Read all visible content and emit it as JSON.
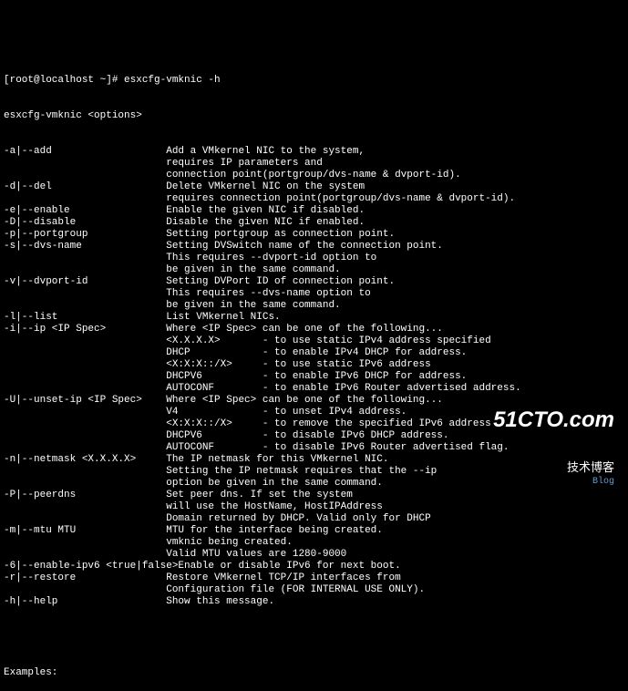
{
  "prompt": "[root@localhost ~]# esxcfg-vmknic -h",
  "usage_line": "esxcfg-vmknic <options>",
  "options": [
    {
      "flag": "-a|--add",
      "lines": [
        "Add a VMkernel NIC to the system,",
        "requires IP parameters and",
        "connection point(portgroup/dvs-name & dvport-id)."
      ]
    },
    {
      "flag": "-d|--del",
      "lines": [
        "Delete VMkernel NIC on the system",
        "requires connection point(portgroup/dvs-name & dvport-id)."
      ]
    },
    {
      "flag": "-e|--enable",
      "lines": [
        "Enable the given NIC if disabled."
      ]
    },
    {
      "flag": "-D|--disable",
      "lines": [
        "Disable the given NIC if enabled."
      ]
    },
    {
      "flag": "-p|--portgroup",
      "lines": [
        "Setting portgroup as connection point."
      ]
    },
    {
      "flag": "-s|--dvs-name",
      "lines": [
        "Setting DVSwitch name of the connection point.",
        "This requires --dvport-id option to",
        "be given in the same command."
      ]
    },
    {
      "flag": "-v|--dvport-id",
      "lines": [
        "Setting DVPort ID of connection point.",
        "This requires --dvs-name option to",
        "be given in the same command."
      ]
    },
    {
      "flag": "-l|--list",
      "lines": [
        "List VMkernel NICs."
      ]
    },
    {
      "flag": "-i|--ip <IP Spec>",
      "lines": [
        "Where <IP Spec> can be one of the following...",
        "<X.X.X.X>       - to use static IPv4 address specified",
        "DHCP            - to enable IPv4 DHCP for address.",
        "<X:X:X::/X>     - to use static IPv6 address",
        "DHCPV6          - to enable IPv6 DHCP for address.",
        "AUTOCONF        - to enable IPv6 Router advertised address."
      ]
    },
    {
      "flag": "-U|--unset-ip <IP Spec>",
      "lines": [
        "Where <IP Spec> can be one of the following...",
        "V4              - to unset IPv4 address.",
        "<X:X:X::/X>     - to remove the specified IPv6 address",
        "DHCPV6          - to disable IPv6 DHCP address.",
        "AUTOCONF        - to disable IPv6 Router advertised flag."
      ]
    },
    {
      "flag": "-n|--netmask <X.X.X.X>",
      "lines": [
        "The IP netmask for this VMkernel NIC.",
        "Setting the IP netmask requires that the --ip",
        "option be given in the same command."
      ]
    },
    {
      "flag": "-P|--peerdns",
      "lines": [
        "Set peer dns. If set the system",
        "will use the HostName, HostIPAddress",
        "Domain returned by DHCP. Valid only for DHCP"
      ]
    },
    {
      "flag": "-m|--mtu MTU",
      "lines": [
        "MTU for the interface being created.",
        "vmknic being created.",
        "Valid MTU values are 1280-9000"
      ]
    },
    {
      "flag": "-6|--enable-ipv6 <true|false>",
      "lines": [
        "Enable or disable IPv6 for next boot."
      ]
    },
    {
      "flag": "-r|--restore",
      "lines": [
        "Restore VMkernel TCP/IP interfaces from",
        "Configuration file (FOR INTERNAL USE ONLY)."
      ]
    },
    {
      "flag": "-h|--help",
      "lines": [
        "Show this message."
      ]
    }
  ],
  "examples_label": "Examples:",
  "watermark": {
    "main": "51CTO.com",
    "sub": "技术博客",
    "blog": "Blog"
  }
}
